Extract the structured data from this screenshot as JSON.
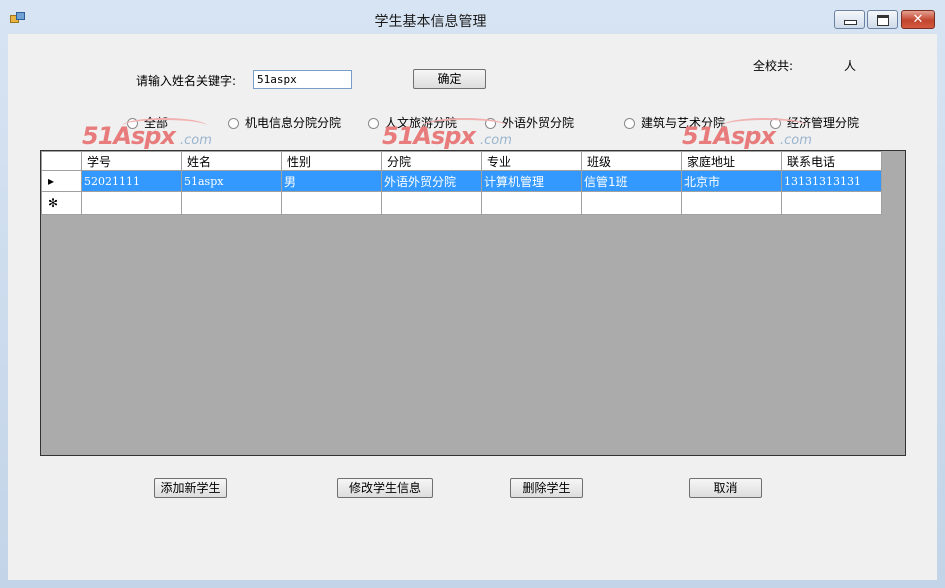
{
  "window": {
    "title": "学生基本信息管理",
    "close_glyph": "✕"
  },
  "search": {
    "label": "请输入姓名关键字:",
    "value": "51aspx",
    "confirm_label": "确定"
  },
  "total": {
    "label": "全校共:",
    "unit": "人"
  },
  "departments": [
    {
      "label": "全部"
    },
    {
      "label": "机电信息分院分院"
    },
    {
      "label": "人文旅游分院"
    },
    {
      "label": "外语外贸分院"
    },
    {
      "label": "建筑与艺术分院"
    },
    {
      "label": "经济管理分院"
    }
  ],
  "watermark": {
    "brand": "51Aspx",
    "suffix": ".com"
  },
  "grid": {
    "columns": [
      "学号",
      "姓名",
      "性别",
      "分院",
      "专业",
      "班级",
      "家庭地址",
      "联系电话"
    ],
    "rows": [
      [
        "52021111",
        "51aspx",
        "男",
        "外语外贸分院",
        "计算机管理",
        "信管1班",
        "北京市",
        "13131313131"
      ]
    ],
    "current_row_glyph": "▸",
    "new_row_glyph": "✻"
  },
  "actions": {
    "add": "添加新学生",
    "edit": "修改学生信息",
    "delete": "删除学生",
    "cancel": "取消"
  }
}
